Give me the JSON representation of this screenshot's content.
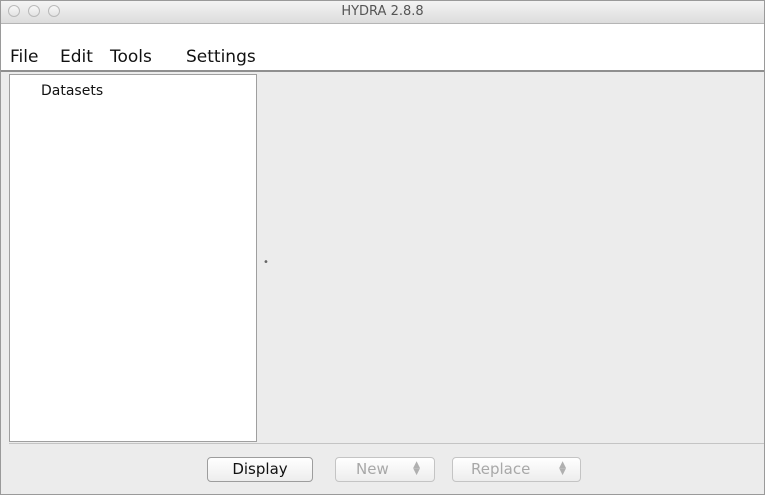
{
  "window": {
    "title": "HYDRA 2.8.8"
  },
  "menubar": {
    "items": [
      "File",
      "Edit",
      "Tools",
      "Settings"
    ]
  },
  "tree": {
    "root_label": "Datasets"
  },
  "bottom": {
    "display_label": "Display",
    "new_label": "New",
    "replace_label": "Replace"
  },
  "colors": {
    "window_bg": "#ececec",
    "panel_bg": "#ffffff"
  },
  "icons": {
    "window_controls": [
      "close-icon",
      "minimize-icon",
      "zoom-icon"
    ],
    "stepper": "stepper-arrows-icon"
  }
}
